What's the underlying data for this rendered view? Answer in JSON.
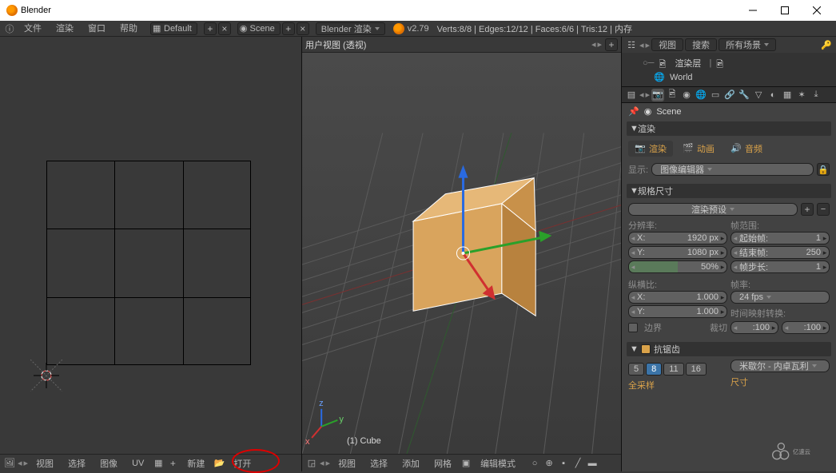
{
  "titlebar": {
    "title": "Blender"
  },
  "info": {
    "menus": [
      "文件",
      "渲染",
      "窗口",
      "帮助"
    ],
    "layout": "Default",
    "scene": "Scene",
    "engine": "Blender 渲染",
    "version": "v2.79",
    "stats": "Verts:8/8 | Edges:12/12 | Faces:6/6 | Tris:12 | 内存"
  },
  "uv": {
    "footer": {
      "view": "视图",
      "select": "选择",
      "image": "图像",
      "uvs": "UV",
      "new": "新建",
      "open": "打开"
    }
  },
  "view3d": {
    "header_title": "用户视图 (透视)",
    "object_name": "(1) Cube",
    "footer": {
      "view": "视图",
      "select": "选择",
      "add": "添加",
      "mesh": "网格",
      "mode": "编辑模式"
    }
  },
  "outliner": {
    "header": {
      "view": "视图",
      "search": "搜索",
      "all_scenes": "所有场景"
    },
    "rows": [
      {
        "name": "渲染层"
      },
      {
        "name": "World"
      }
    ]
  },
  "props": {
    "crumb": "Scene",
    "render": {
      "panel": "渲染",
      "render_btn": "渲染",
      "anim_btn": "动画",
      "audio_btn": "音频",
      "display_lbl": "显示:",
      "display_val": "图像编辑器"
    },
    "dims": {
      "panel": "规格尺寸",
      "preset": "渲染预设",
      "res_lbl": "分辨率:",
      "frame_lbl": "帧范围:",
      "x_lbl": "X:",
      "y_lbl": "Y:",
      "res_x": "1920 px",
      "res_y": "1080 px",
      "pct": "50%",
      "start_lbl": "起始帧:",
      "start": "1",
      "end_lbl": "结束帧:",
      "end": "250",
      "step_lbl": "帧步长:",
      "step": "1",
      "aspect_lbl": "纵横比:",
      "fps_lbl": "帧率:",
      "ax": "1.000",
      "ay": "1.000",
      "fps": "24 fps",
      "remap_lbl": "时间映射转换:",
      "remap_a": ":100",
      "remap_b": ":100",
      "border": "边界",
      "crop": "裁切"
    },
    "aa": {
      "panel": "抗锯齿",
      "samples": [
        "5",
        "8",
        "11",
        "16"
      ],
      "active": "8",
      "filter": "米歇尔 - 内卓瓦利",
      "full": "全采样",
      "size_lbl": "尺寸"
    }
  }
}
